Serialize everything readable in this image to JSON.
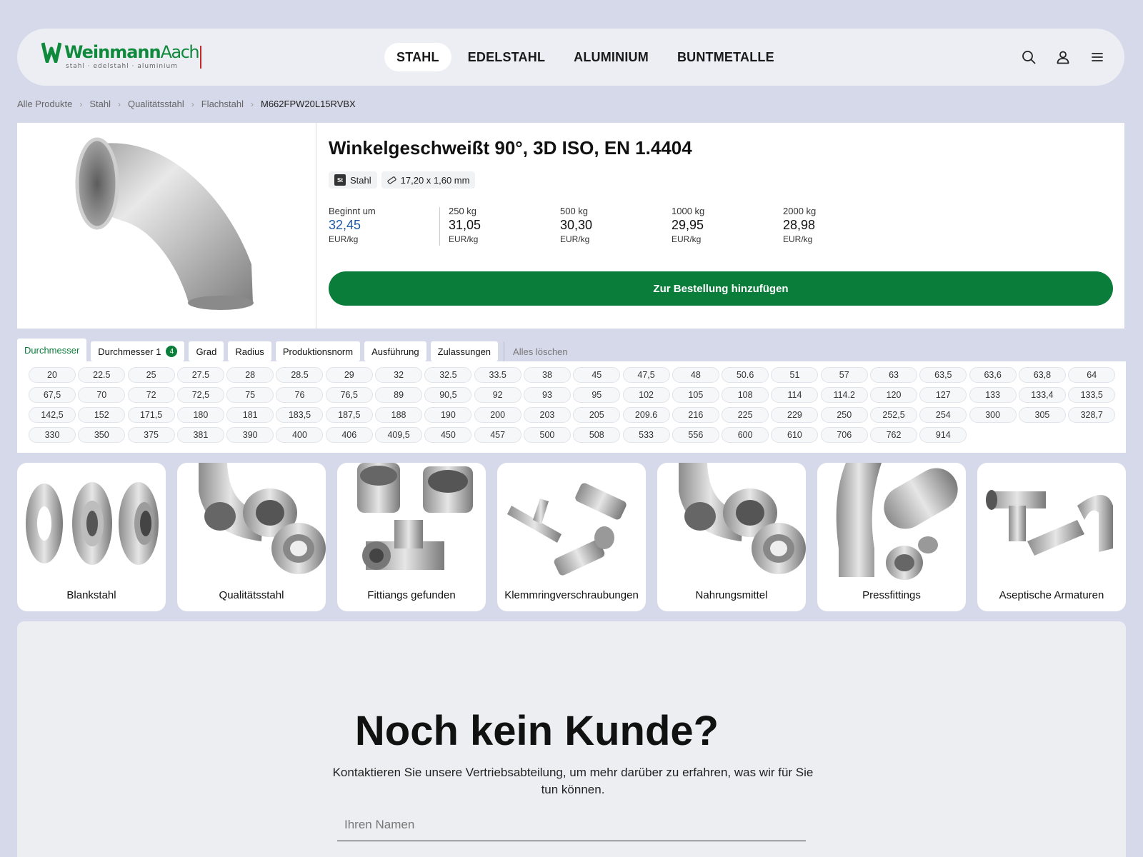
{
  "header": {
    "logo": {
      "name": "Weinmann",
      "suffix": "Aach",
      "tagline": "stahl · edelstahl · aluminium"
    },
    "nav": [
      {
        "label": "STAHL",
        "active": true
      },
      {
        "label": "EDELSTAHL",
        "active": false
      },
      {
        "label": "ALUMINIUM",
        "active": false
      },
      {
        "label": "BUNTMETALLE",
        "active": false
      }
    ],
    "icons": [
      "search-icon",
      "user-icon",
      "menu-icon"
    ]
  },
  "breadcrumb": [
    "Alle Produkte",
    "Stahl",
    "Qualitätsstahl",
    "Flachstahl",
    "M662FPW20L15RVBX"
  ],
  "product": {
    "title": "Winkelgeschweißt 90°, 3D ISO, EN 1.4404",
    "chips": {
      "material_abbr": "St",
      "material": "Stahl",
      "dimension": "17,20 x 1,60 mm"
    },
    "prices": [
      {
        "qty": "Beginnt um",
        "value": "32,45",
        "unit": "EUR/kg"
      },
      {
        "qty": "250 kg",
        "value": "31,05",
        "unit": "EUR/kg"
      },
      {
        "qty": "500 kg",
        "value": "30,30",
        "unit": "EUR/kg"
      },
      {
        "qty": "1000 kg",
        "value": "29,95",
        "unit": "EUR/kg"
      },
      {
        "qty": "2000 kg",
        "value": "28,98",
        "unit": "EUR/kg"
      }
    ],
    "order_button": "Zur Bestellung hinzufügen",
    "accent_color": "#0b7d3a",
    "price_highlight_color": "#1e5aa8"
  },
  "filters": {
    "tabs": [
      {
        "label": "Durchmesser",
        "active": true
      },
      {
        "label": "Durchmesser 1",
        "badge": "4"
      },
      {
        "label": "Grad"
      },
      {
        "label": "Radius"
      },
      {
        "label": "Produktionsnorm"
      },
      {
        "label": "Ausführung"
      },
      {
        "label": "Zulassungen"
      }
    ],
    "clear_label": "Alles löschen",
    "values": [
      "20",
      "22.5",
      "25",
      "27.5",
      "28",
      "28.5",
      "29",
      "32",
      "32.5",
      "33.5",
      "38",
      "45",
      "47,5",
      "48",
      "50.6",
      "51",
      "57",
      "63",
      "63,5",
      "63,6",
      "63,8",
      "64",
      "67,5",
      "70",
      "72",
      "72,5",
      "75",
      "76",
      "76,5",
      "89",
      "90,5",
      "92",
      "93",
      "95",
      "102",
      "105",
      "108",
      "114",
      "114.2",
      "120",
      "127",
      "133",
      "133,4",
      "133,5",
      "142,5",
      "152",
      "171,5",
      "180",
      "181",
      "183,5",
      "187,5",
      "188",
      "190",
      "200",
      "203",
      "205",
      "209.6",
      "216",
      "225",
      "229",
      "250",
      "252,5",
      "254",
      "300",
      "305",
      "328,7",
      "330",
      "350",
      "375",
      "381",
      "390",
      "400",
      "406",
      "409,5",
      "450",
      "457",
      "500",
      "508",
      "533",
      "556",
      "600",
      "610",
      "706",
      "762",
      "914"
    ]
  },
  "categories": [
    {
      "label": "Blankstahl",
      "icon": "flanges-icon"
    },
    {
      "label": "Qualitätsstahl",
      "icon": "pipe-fittings-icon"
    },
    {
      "label": "Fittiangs gefunden",
      "icon": "threaded-fittings-icon"
    },
    {
      "label": "Klemmringverschraubungen",
      "icon": "compression-fittings-icon"
    },
    {
      "label": "Nahrungsmittel",
      "icon": "food-fittings-icon"
    },
    {
      "label": "Pressfittings",
      "icon": "press-fittings-icon"
    },
    {
      "label": "Aseptische Armaturen",
      "icon": "aseptic-fittings-icon"
    }
  ],
  "contact": {
    "title": "Noch kein Kunde?",
    "text": "Kontaktieren Sie unsere Vertriebsabteilung, um mehr darüber zu erfahren, was wir für Sie tun können.",
    "name_placeholder": "Ihren Namen"
  }
}
